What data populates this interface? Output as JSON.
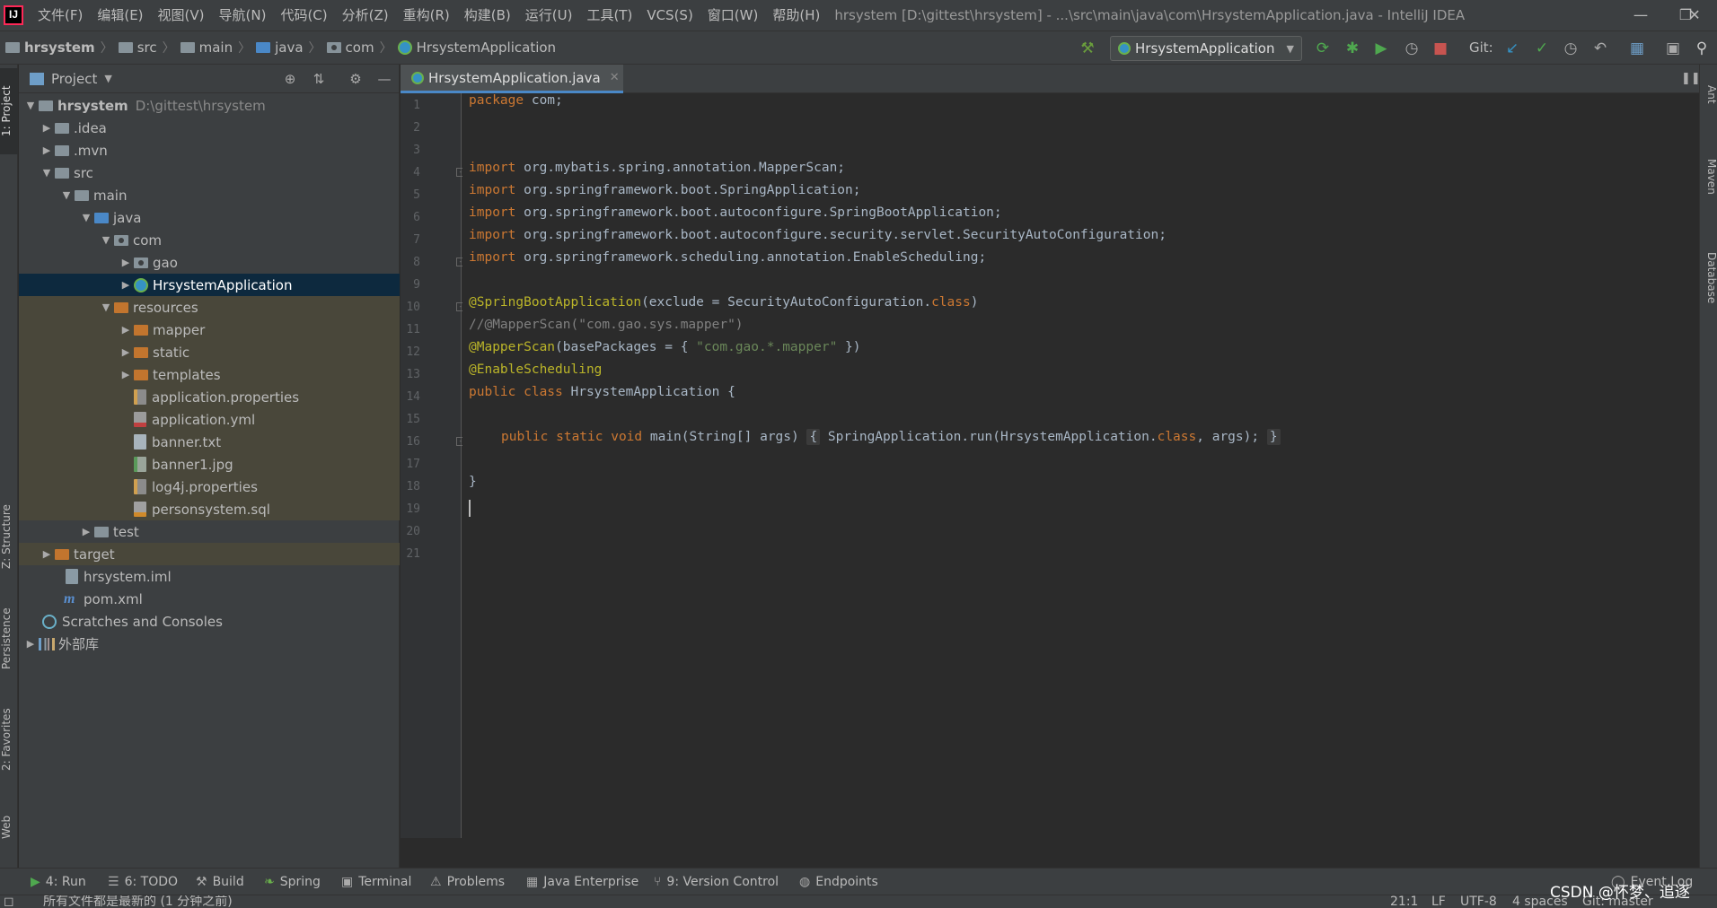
{
  "menubar": {
    "items": [
      "文件(F)",
      "编辑(E)",
      "视图(V)",
      "导航(N)",
      "代码(C)",
      "分析(Z)",
      "重构(R)",
      "构建(B)",
      "运行(U)",
      "工具(T)",
      "VCS(S)",
      "窗口(W)",
      "帮助(H)"
    ],
    "window_title": "hrsystem [D:\\gittest\\hrsystem] - ...\\src\\main\\java\\com\\HrsystemApplication.java - IntelliJ IDEA",
    "logo_text": "IJ"
  },
  "navbar": {
    "breadcrumbs": [
      "hrsystem",
      "src",
      "main",
      "java",
      "com",
      "HrsystemApplication"
    ],
    "run_config": "HrsystemApplication",
    "git_label": "Git:"
  },
  "project": {
    "title": "Project",
    "tree": [
      {
        "label": "hrsystem",
        "dim": "D:\\gittest\\hrsystem"
      },
      {
        "label": ".idea"
      },
      {
        "label": ".mvn"
      },
      {
        "label": "src"
      },
      {
        "label": "main"
      },
      {
        "label": "java"
      },
      {
        "label": "com"
      },
      {
        "label": "gao"
      },
      {
        "label": "HrsystemApplication"
      },
      {
        "label": "resources"
      },
      {
        "label": "mapper"
      },
      {
        "label": "static"
      },
      {
        "label": "templates"
      },
      {
        "label": "application.properties"
      },
      {
        "label": "application.yml"
      },
      {
        "label": "banner.txt"
      },
      {
        "label": "banner1.jpg"
      },
      {
        "label": "log4j.properties"
      },
      {
        "label": "personsystem.sql"
      },
      {
        "label": "test"
      },
      {
        "label": "target"
      },
      {
        "label": "hrsystem.iml"
      },
      {
        "label": "pom.xml"
      },
      {
        "label": "Scratches and Consoles"
      },
      {
        "label": "外部库"
      }
    ]
  },
  "left_tabs": {
    "project": "1: Project",
    "structure": "Z: Structure",
    "persistence": "Persistence",
    "favorites": "2: Favorites",
    "web": "Web"
  },
  "right_tabs": {
    "ant": "Ant",
    "maven": "Maven",
    "database": "Database"
  },
  "editor": {
    "tab_label": "HrsystemApplication.java",
    "line_numbers": [
      "1",
      "2",
      "3",
      "4",
      "5",
      "6",
      "7",
      "8",
      "9",
      "10",
      "11",
      "12",
      "13",
      "14",
      "15",
      "16",
      "17",
      "18",
      "19",
      "20",
      "21"
    ],
    "code": {
      "l1_kw": "package",
      "l1_rest": " com;",
      "l4_kw": "import",
      "l4_rest": " org.mybatis.spring.annotation.MapperScan;",
      "l5_kw": "import",
      "l5_rest": " org.springframework.boot.SpringApplication;",
      "l6_kw": "import",
      "l6_rest": " org.springframework.boot.autoconfigure.SpringBootApplication;",
      "l7_kw": "import",
      "l7_rest": " org.springframework.boot.autoconfigure.security.servlet.SecurityAutoConfiguration;",
      "l8_kw": "import",
      "l8_rest": " org.springframework.scheduling.annotation.EnableScheduling;",
      "l10_an": "@SpringBootApplication",
      "l10_a": "(exclude = SecurityAutoConfiguration.",
      "l10_kw": "class",
      "l10_b": ")",
      "l11_cm": "//@MapperScan(\"com.gao.sys.mapper\")",
      "l12_an": "@MapperScan",
      "l12_a": "(basePackages = { ",
      "l12_st": "\"com.gao.*.mapper\"",
      "l12_b": " })",
      "l13_an": "@EnableScheduling",
      "l14_kw": "public class",
      "l14_rest": " HrsystemApplication {",
      "l16_kw": "public static void",
      "l16_a": " main(String[] args) ",
      "l16_f1": "{",
      "l16_b": " SpringApplication.run(HrsystemApplication.",
      "l16_kw2": "class",
      "l16_c": ", args); ",
      "l16_f2": "}",
      "l20": "}"
    }
  },
  "bottom_tools": {
    "run": "4: Run",
    "todo": "6: TODO",
    "build": "Build",
    "spring": "Spring",
    "terminal": "Terminal",
    "problems": "Problems",
    "java_ent": "Java Enterprise",
    "vcs": "9: Version Control",
    "endpoints": "Endpoints",
    "event_log": "Event Log"
  },
  "statusbar": {
    "message": "所有文件都是最新的 (1 分钟之前)",
    "position": "21:1",
    "line_sep": "LF",
    "encoding": "UTF-8",
    "indent": "4 spaces",
    "git": "Git: master"
  },
  "watermark": "CSDN @怀梦、追逐",
  "colors": {
    "keyword": "#cc7832",
    "annotation": "#bbb529",
    "string": "#6a8759",
    "comment": "#808080",
    "selection": "#0d293e",
    "resources_bg": "#49473a"
  }
}
